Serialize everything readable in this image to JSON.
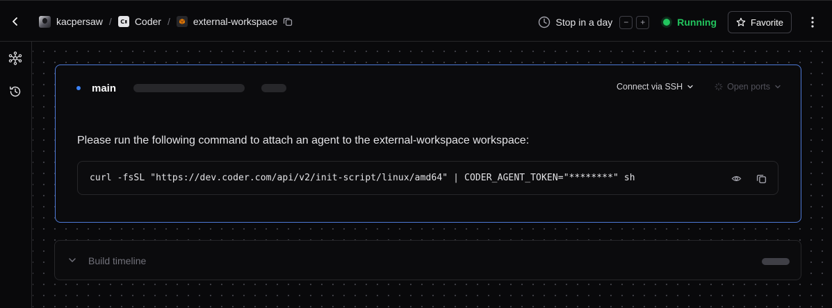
{
  "topbar": {
    "breadcrumbs": [
      {
        "label": "kacpersaw",
        "icon": "user-avatar-icon"
      },
      {
        "label": "Coder",
        "icon": "coder-logo-icon"
      },
      {
        "label": "external-workspace",
        "icon": "workspace-box-icon"
      }
    ],
    "separator": "/",
    "logo_text": "C",
    "schedule_label": "Stop in a day",
    "decrement_label": "−",
    "increment_label": "+",
    "status_label": "Running",
    "favorite_label": "Favorite"
  },
  "agent": {
    "name": "main",
    "connect_ssh_label": "Connect via SSH",
    "open_ports_label": "Open ports",
    "instruction": "Please run the following command to attach an agent to the external-workspace workspace:",
    "command": "curl -fsSL \"https://dev.coder.com/api/v2/init-script/linux/amd64\" | CODER_AGENT_TOKEN=\"********\" sh"
  },
  "timeline": {
    "label": "Build timeline"
  },
  "colors": {
    "accent_blue": "#3b82f6",
    "running_green": "#22c55e",
    "card_border": "#4f7bd9"
  }
}
